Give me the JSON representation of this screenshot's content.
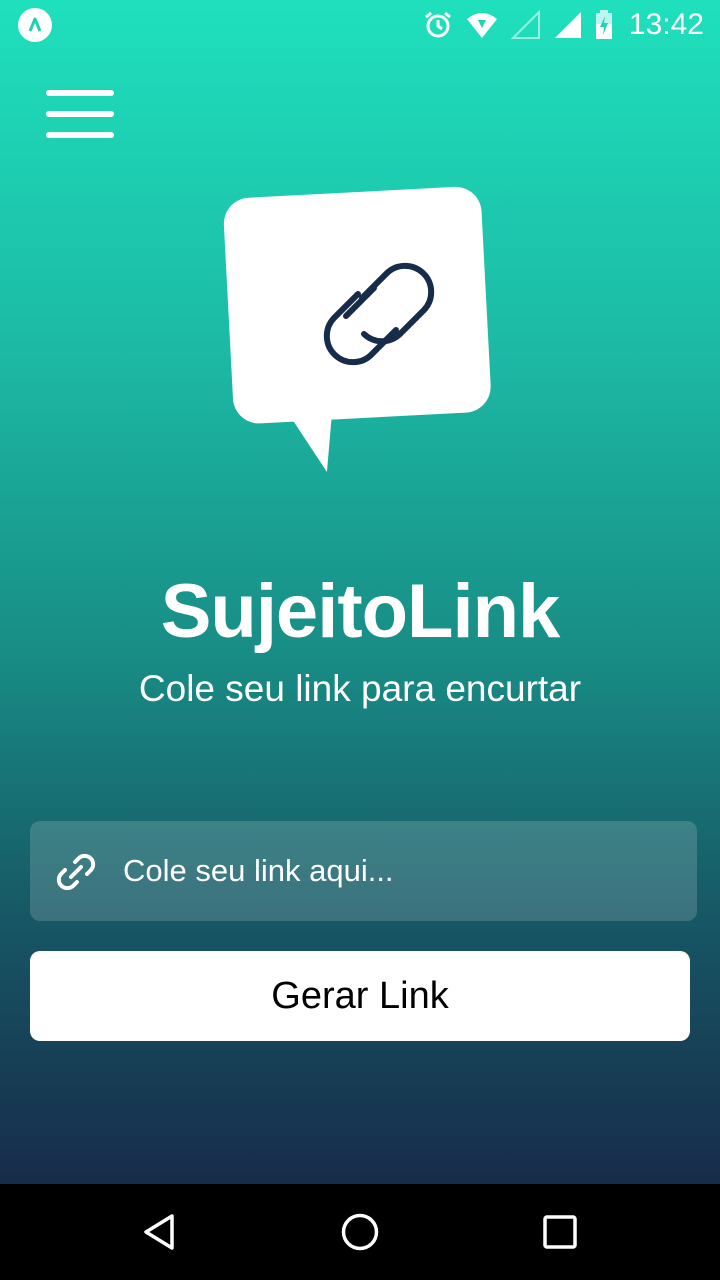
{
  "status_bar": {
    "time": "13:42",
    "icons": [
      "alarm-icon",
      "wifi-icon",
      "signal-empty-icon",
      "signal-full-icon",
      "battery-charging-icon"
    ]
  },
  "app": {
    "title": "SujeitoLink",
    "subtitle": "Cole seu link para encurtar",
    "input": {
      "placeholder": "Cole seu link aqui...",
      "value": "",
      "icon": "link-icon"
    },
    "button_label": "Gerar Link",
    "menu_icon": "hamburger-menu-icon",
    "logo_icon": "chain-link-icon"
  },
  "colors": {
    "gradient_top": "#1fe0bd",
    "gradient_bottom": "#172b4a",
    "logo_stroke": "#172b4a"
  },
  "nav_bar": {
    "buttons": [
      "back-icon",
      "home-icon",
      "recents-icon"
    ]
  }
}
